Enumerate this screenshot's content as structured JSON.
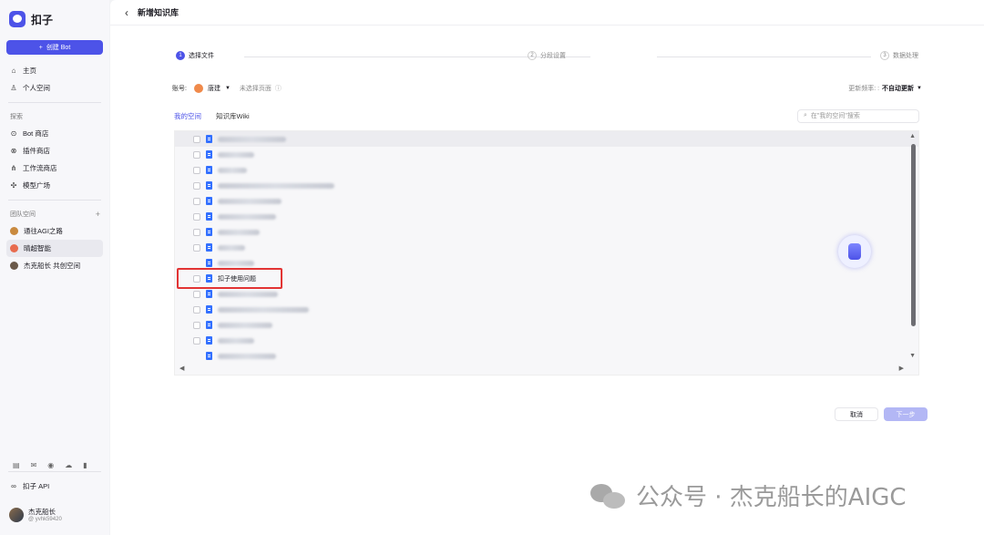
{
  "app": {
    "name": "扣子"
  },
  "sidebar": {
    "create_label": "创建 Bot",
    "main_items": [
      {
        "label": "主页",
        "icon": "home-icon"
      },
      {
        "label": "个人空间",
        "icon": "user-icon"
      }
    ],
    "explore_title": "探索",
    "explore_items": [
      {
        "label": "Bot 商店",
        "icon": "bot-store-icon"
      },
      {
        "label": "插件商店",
        "icon": "plugin-store-icon"
      },
      {
        "label": "工作流商店",
        "icon": "workflow-store-icon"
      },
      {
        "label": "模型广场",
        "icon": "model-square-icon"
      }
    ],
    "team_title": "团队空间",
    "team_items": [
      {
        "label": "通往AGI之路",
        "color": "#c98a3f"
      },
      {
        "label": "晴超智能",
        "color": "#e86c4f",
        "active": true
      },
      {
        "label": "杰克船长 共创空间",
        "color": "#6b5a4a"
      }
    ],
    "api_label": "扣子 API",
    "user": {
      "name": "杰克船长",
      "id": "@ yvhk59420"
    }
  },
  "page": {
    "title": "新增知识库"
  },
  "steps": [
    {
      "num": "1",
      "label": "选择文件"
    },
    {
      "num": "2",
      "label": "分段设置"
    },
    {
      "num": "3",
      "label": "数据处理"
    }
  ],
  "account": {
    "label": "账号:",
    "name": "唐建",
    "page_placeholder": "未选择页面",
    "freq_label": "更新频率: :",
    "freq_value": "不自动更新"
  },
  "tabs": [
    "我的空间",
    "知识库Wiki"
  ],
  "search": {
    "placeholder": "在\"我的空间\"搜索"
  },
  "list": {
    "visible_label": "扣子使用问题",
    "visible_label_index": 9
  },
  "actions": {
    "cancel": "取消",
    "next": "下一步"
  },
  "watermark": "公众号 · 杰克船长的AIGC",
  "colors": {
    "accent": "#4d53e8",
    "highlight": "#e23434"
  }
}
